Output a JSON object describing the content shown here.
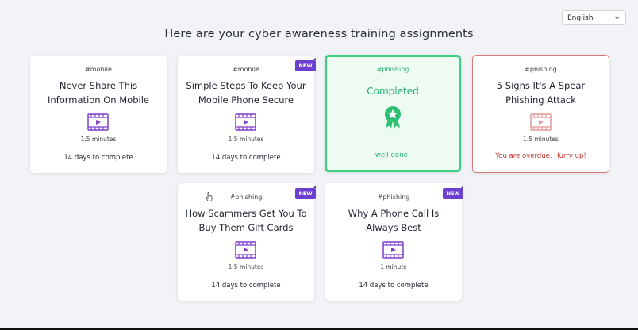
{
  "language": {
    "selected": "English"
  },
  "page": {
    "title": "Here are your cyber awareness training assignments"
  },
  "cards": [
    {
      "tag": "#mobile",
      "title": "Never Share This Information On Mobile",
      "duration": "1.5 minutes",
      "footer": "14 days to complete",
      "badge": null,
      "status": "pending",
      "icon": "video-icon"
    },
    {
      "tag": "#mobile",
      "title": "Simple Steps To Keep Your Mobile Phone Secure",
      "duration": "1.5 minutes",
      "footer": "14 days to complete",
      "badge": "NEW",
      "status": "pending",
      "icon": "video-icon"
    },
    {
      "tag": "#phishing",
      "title": "Completed",
      "footer": "well done!",
      "status": "completed",
      "icon": "award-icon"
    },
    {
      "tag": "#phishing",
      "title": "5 Signs It's A Spear Phishing Attack",
      "duration": "1.5 minutes",
      "footer": "You are overdue. Hurry up!",
      "badge": null,
      "status": "overdue",
      "icon": "video-icon"
    },
    {
      "tag": "#phishing",
      "title": "How Scammers Get You To Buy Them Gift Cards",
      "duration": "1.5 minutes",
      "footer": "14 days to complete",
      "badge": "NEW",
      "status": "pending",
      "icon": "video-icon"
    },
    {
      "tag": "#phishing",
      "title": "Why A Phone Call Is Always Best",
      "duration": "1 minute",
      "footer": "14 days to complete",
      "badge": "NEW",
      "status": "pending",
      "icon": "video-icon"
    }
  ],
  "colors": {
    "accent_purple": "#6d3fd1",
    "completed_green": "#3ccf80",
    "overdue_red": "#c2342d",
    "background": "#f1f3f6"
  }
}
